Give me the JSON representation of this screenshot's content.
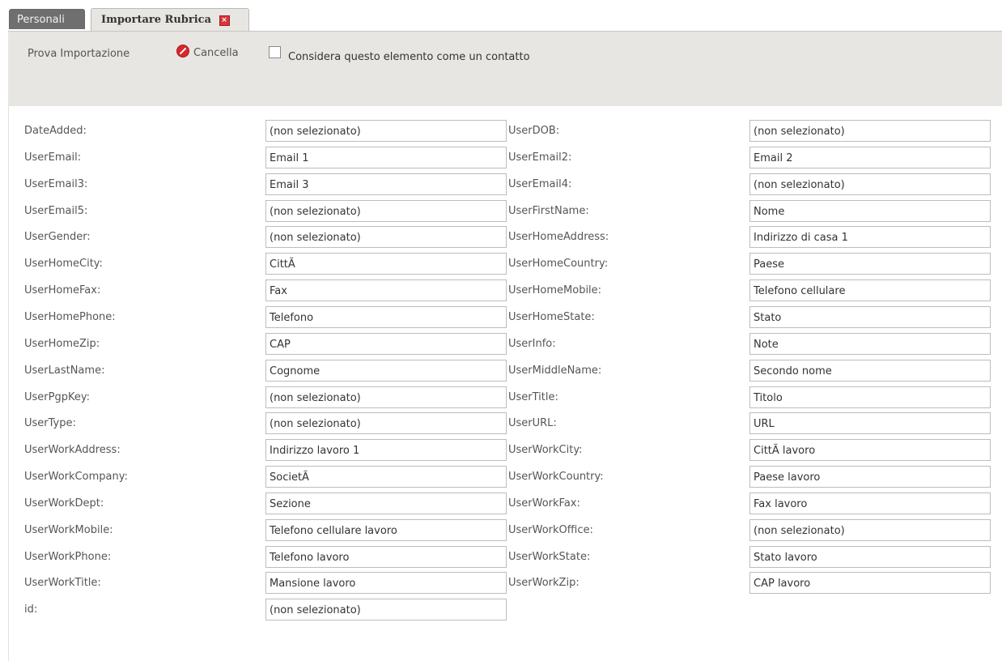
{
  "tabs": [
    {
      "label": "Personali"
    },
    {
      "label": "Importare Rubrica"
    }
  ],
  "toolbar": {
    "prova_label": "Prova Importazione",
    "cancella_label": "Cancella",
    "consider_label": "Considera questo elemento come un contatto",
    "consider_checked": false
  },
  "fields": [
    {
      "label": "DateAdded:",
      "value": "(non selezionato)"
    },
    {
      "label": "UserDOB:",
      "value": "(non selezionato)"
    },
    {
      "label": "UserEmail:",
      "value": "Email 1"
    },
    {
      "label": "UserEmail2:",
      "value": "Email 2"
    },
    {
      "label": "UserEmail3:",
      "value": "Email 3"
    },
    {
      "label": "UserEmail4:",
      "value": "(non selezionato)"
    },
    {
      "label": "UserEmail5:",
      "value": "(non selezionato)"
    },
    {
      "label": "UserFirstName:",
      "value": "Nome"
    },
    {
      "label": "UserGender:",
      "value": "(non selezionato)"
    },
    {
      "label": "UserHomeAddress:",
      "value": "Indirizzo di casa 1"
    },
    {
      "label": "UserHomeCity:",
      "value": "CittÃ"
    },
    {
      "label": "UserHomeCountry:",
      "value": "Paese"
    },
    {
      "label": "UserHomeFax:",
      "value": "Fax"
    },
    {
      "label": "UserHomeMobile:",
      "value": "Telefono cellulare"
    },
    {
      "label": "UserHomePhone:",
      "value": "Telefono"
    },
    {
      "label": "UserHomeState:",
      "value": "Stato"
    },
    {
      "label": "UserHomeZip:",
      "value": "CAP"
    },
    {
      "label": "UserInfo:",
      "value": "Note"
    },
    {
      "label": "UserLastName:",
      "value": "Cognome"
    },
    {
      "label": "UserMiddleName:",
      "value": "Secondo nome"
    },
    {
      "label": "UserPgpKey:",
      "value": "(non selezionato)"
    },
    {
      "label": "UserTitle:",
      "value": "Titolo"
    },
    {
      "label": "UserType:",
      "value": "(non selezionato)"
    },
    {
      "label": "UserURL:",
      "value": "URL"
    },
    {
      "label": "UserWorkAddress:",
      "value": "Indirizzo lavoro 1"
    },
    {
      "label": "UserWorkCity:",
      "value": "CittÃ  lavoro"
    },
    {
      "label": "UserWorkCompany:",
      "value": "SocietÃ"
    },
    {
      "label": "UserWorkCountry:",
      "value": "Paese lavoro"
    },
    {
      "label": "UserWorkDept:",
      "value": "Sezione"
    },
    {
      "label": "UserWorkFax:",
      "value": "Fax lavoro"
    },
    {
      "label": "UserWorkMobile:",
      "value": "Telefono cellulare lavoro"
    },
    {
      "label": "UserWorkOffice:",
      "value": "(non selezionato)"
    },
    {
      "label": "UserWorkPhone:",
      "value": "Telefono lavoro"
    },
    {
      "label": "UserWorkState:",
      "value": "Stato lavoro"
    },
    {
      "label": "UserWorkTitle:",
      "value": "Mansione lavoro"
    },
    {
      "label": "UserWorkZip:",
      "value": "CAP lavoro"
    },
    {
      "label": "id:",
      "value": "(non selezionato)"
    }
  ],
  "icons": {
    "cancel": "cancel-icon",
    "tab_close": "close-icon",
    "checkbox": "checkbox-icon"
  },
  "colors": {
    "toolbar_bg": "#e8e6e2",
    "inactive_tab_bg": "#6f6f6f",
    "cancel_red": "#d8262c"
  }
}
